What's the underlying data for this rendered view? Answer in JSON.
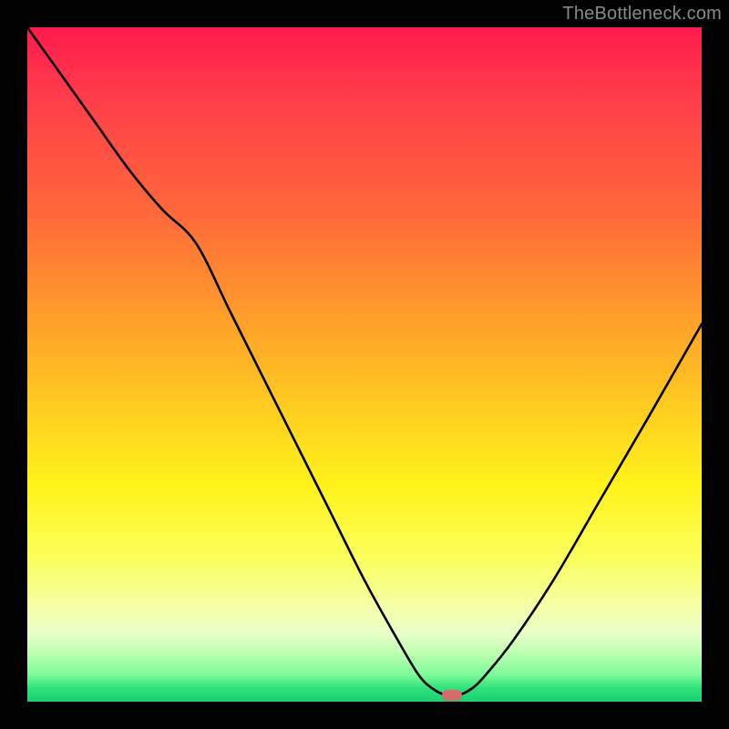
{
  "watermark": "TheBottleneck.com",
  "marker": {
    "x_pct": 63,
    "y_pct": 99,
    "color": "#d96a6a"
  },
  "chart_data": {
    "type": "line",
    "title": "",
    "xlabel": "",
    "ylabel": "",
    "xlim": [
      0,
      100
    ],
    "ylim": [
      0,
      100
    ],
    "grid": false,
    "legend": false,
    "series": [
      {
        "name": "bottleneck-curve",
        "x": [
          0,
          5,
          10,
          15,
          20,
          25,
          30,
          35,
          40,
          45,
          50,
          55,
          58,
          60,
          62,
          64,
          66,
          68,
          72,
          78,
          85,
          92,
          100
        ],
        "y": [
          100,
          93,
          86,
          79,
          73,
          68,
          58,
          48,
          38,
          28,
          18,
          9,
          4,
          2,
          1,
          1,
          2,
          4,
          9,
          18,
          30,
          42,
          56
        ]
      }
    ],
    "background_gradient_stops": [
      {
        "pct": 0,
        "color": "#ff1a4d"
      },
      {
        "pct": 10,
        "color": "#ff3c4a"
      },
      {
        "pct": 28,
        "color": "#ff6a3a"
      },
      {
        "pct": 45,
        "color": "#ffa529"
      },
      {
        "pct": 58,
        "color": "#ffd21f"
      },
      {
        "pct": 68,
        "color": "#fff31a"
      },
      {
        "pct": 79,
        "color": "#fbff5f"
      },
      {
        "pct": 86,
        "color": "#f5ffa8"
      },
      {
        "pct": 90,
        "color": "#e8ffc9"
      },
      {
        "pct": 93,
        "color": "#b9ffaf"
      },
      {
        "pct": 96,
        "color": "#7dfb9a"
      },
      {
        "pct": 98,
        "color": "#2fe27a"
      },
      {
        "pct": 100,
        "color": "#1bcf72"
      }
    ]
  }
}
